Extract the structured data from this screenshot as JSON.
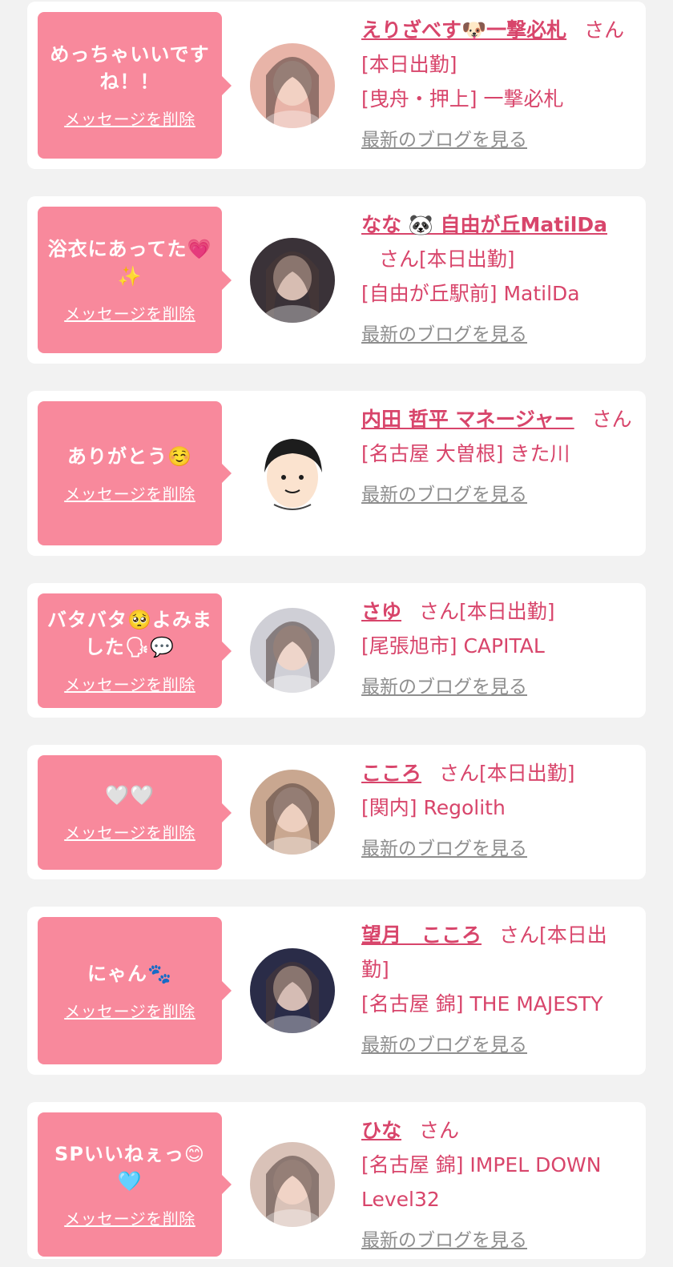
{
  "items": [
    {
      "message": "めっちゃいいですね！！",
      "delete_label": "メッセージを削除",
      "name": "えりざべす🐶一撃必札",
      "honorific": "さん",
      "status": "[本日出勤]",
      "shop": "[曳舟・押上] 一撃必札",
      "blog_label": "最新のブログを見る",
      "avatar_color": "#e8b4a8"
    },
    {
      "message": "浴衣にあってた💗✨",
      "delete_label": "メッセージを削除",
      "name": "なな 🐼 自由が丘MatilDa",
      "honorific": "さん",
      "status": "[本日出勤]",
      "shop": "[自由が丘駅前] MatilDa",
      "blog_label": "最新のブログを見る",
      "avatar_color": "#3a3238"
    },
    {
      "message": "ありがとう☺️",
      "delete_label": "メッセージを削除",
      "name": "内田 哲平 マネージャー",
      "honorific": "さん",
      "status": "",
      "shop": "[名古屋 大曽根] きた川",
      "blog_label": "最新のブログを見る",
      "avatar_color": "#ffffff"
    },
    {
      "message": "バタバタ🥺よみました🗣💬",
      "delete_label": "メッセージを削除",
      "name": "さゆ",
      "honorific": "さん",
      "status": "[本日出勤]",
      "shop": "[尾張旭市] CAPITAL",
      "blog_label": "最新のブログを見る",
      "avatar_color": "#cfcfd6"
    },
    {
      "message": "🤍🤍",
      "delete_label": "メッセージを削除",
      "name": "こころ",
      "honorific": "さん",
      "status": "[本日出勤]",
      "shop": "[関内] Regolith",
      "blog_label": "最新のブログを見る",
      "avatar_color": "#c9a790"
    },
    {
      "message": "にゃん🐾",
      "delete_label": "メッセージを削除",
      "name": "望月　こころ",
      "honorific": "さん",
      "status": "[本日出勤]",
      "shop": "[名古屋 錦] THE MAJESTY",
      "blog_label": "最新のブログを見る",
      "avatar_color": "#2a2c48"
    },
    {
      "message": "SPいいねぇっ😊🩵",
      "delete_label": "メッセージを削除",
      "name": "ひな",
      "honorific": "さん",
      "status": "",
      "shop": "[名古屋 錦] IMPEL DOWN Level32",
      "blog_label": "最新のブログを見る",
      "avatar_color": "#d9c2b8"
    }
  ]
}
